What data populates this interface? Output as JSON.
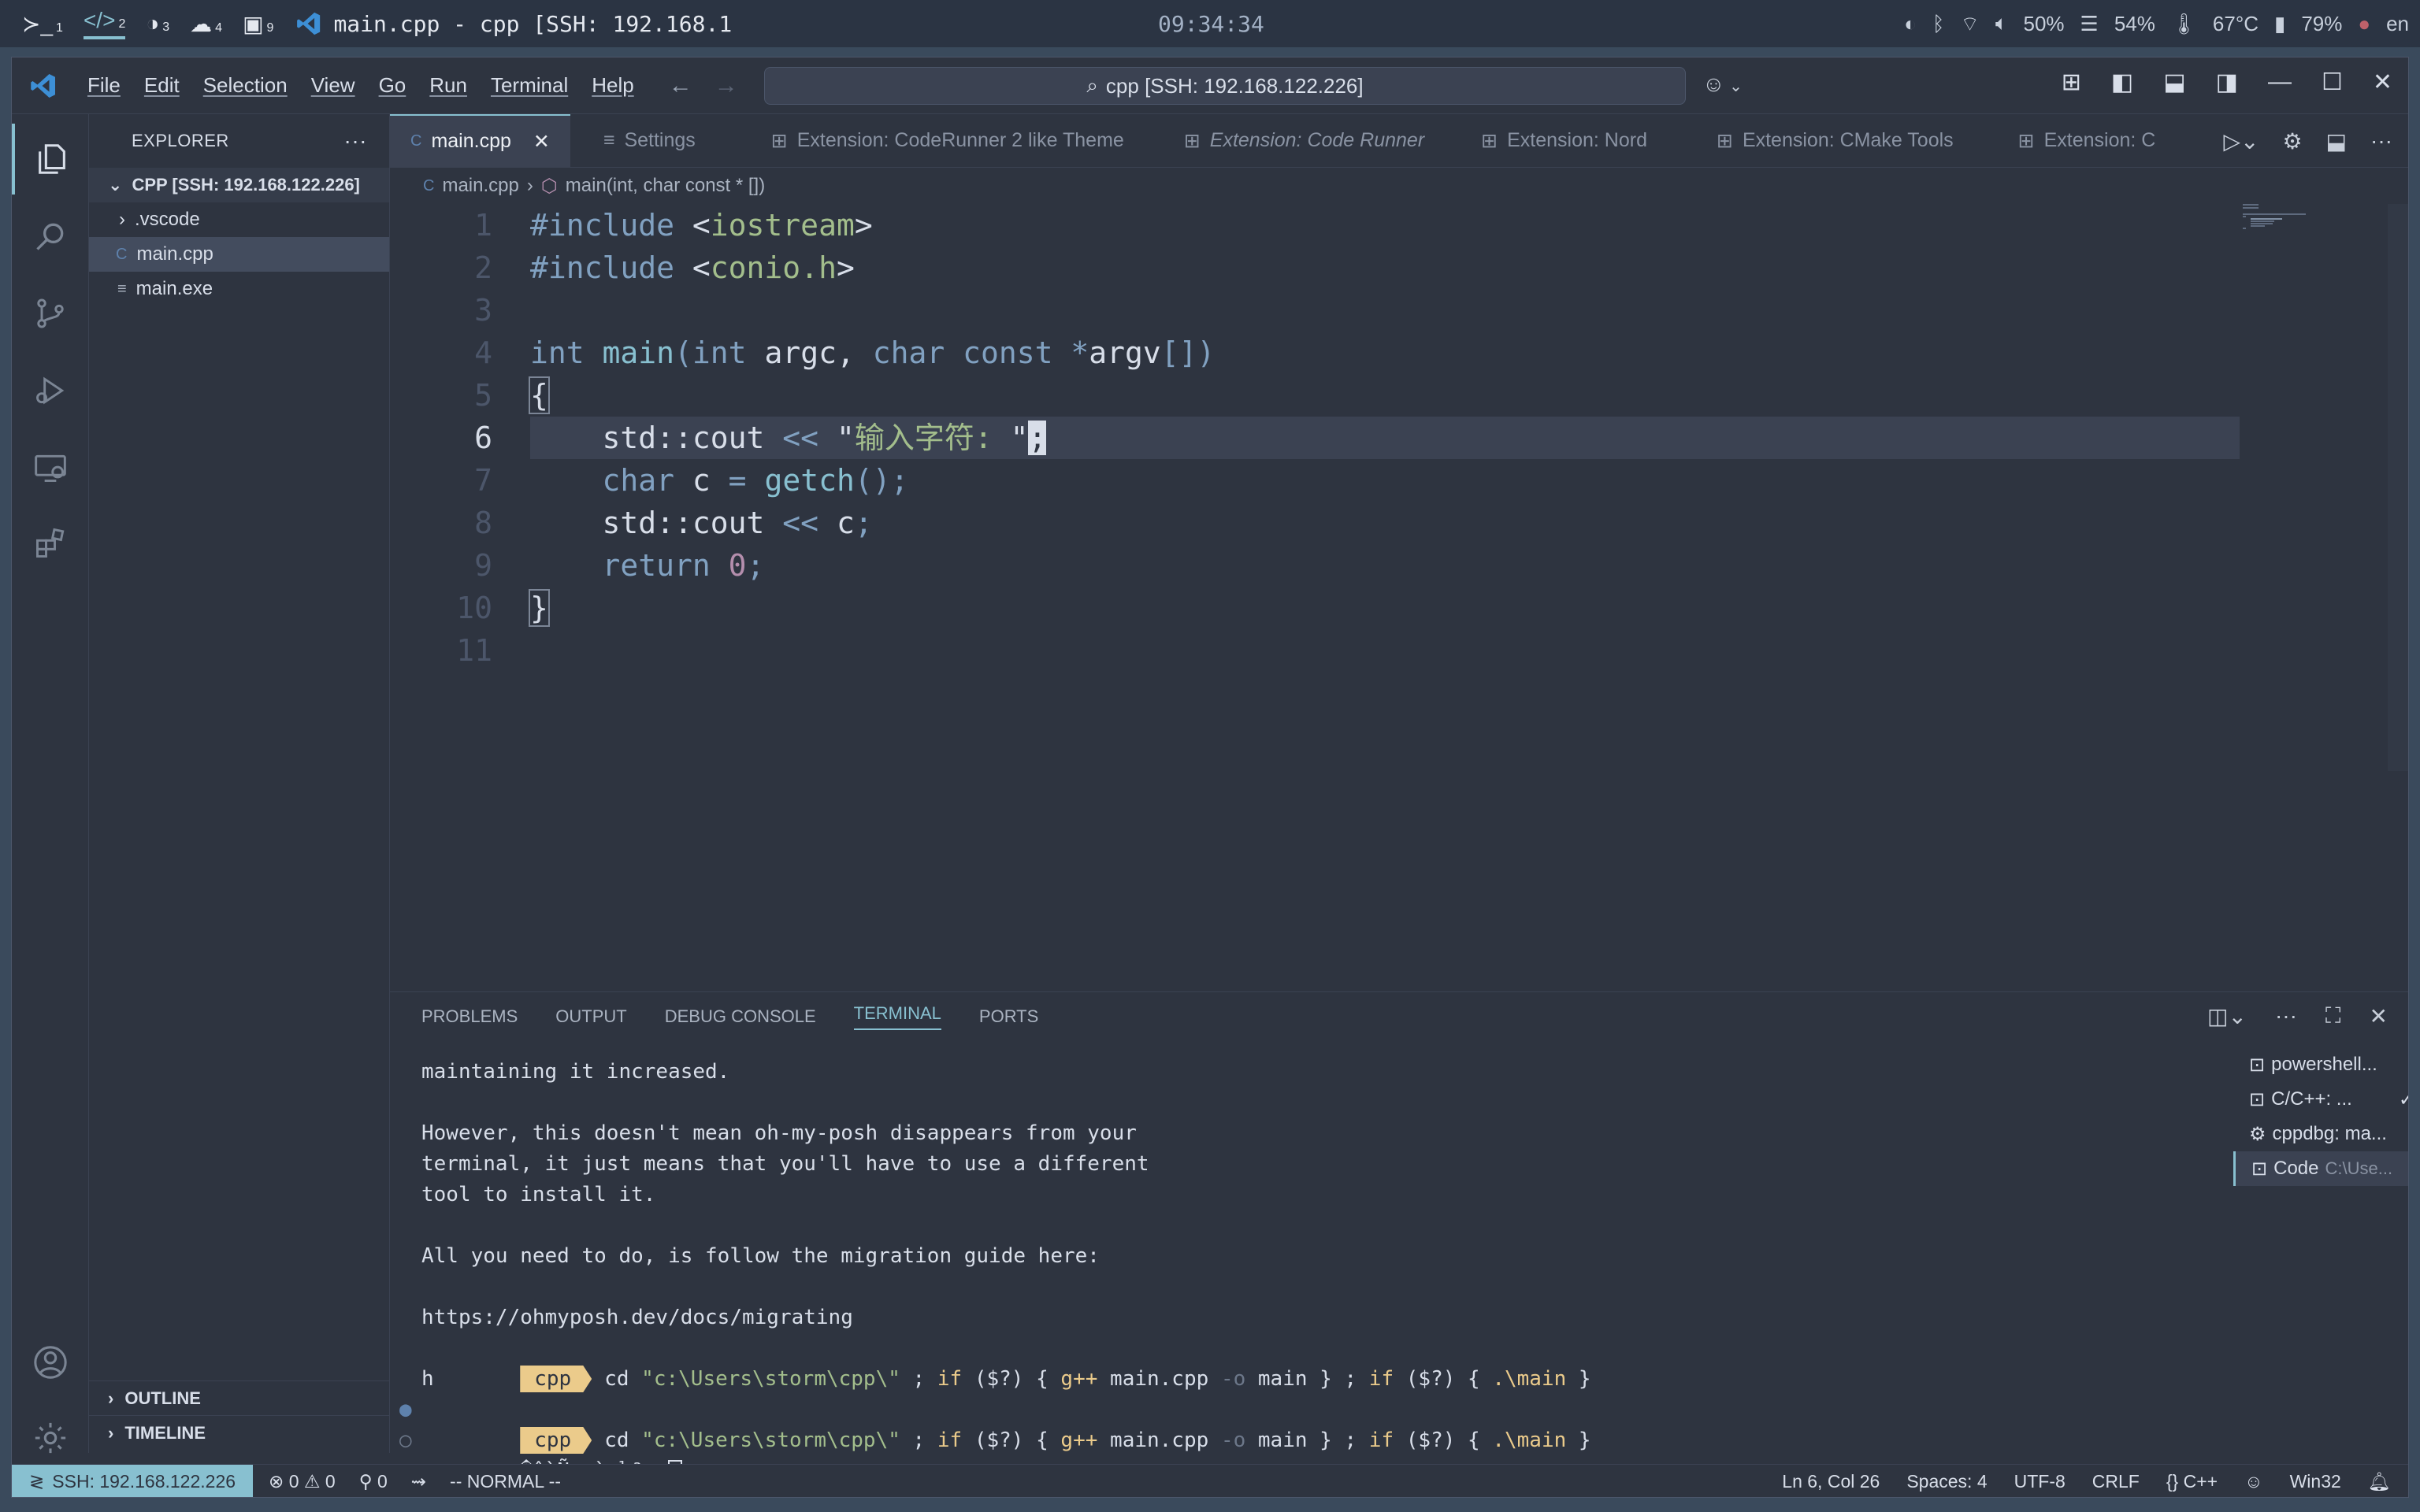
{
  "topbar": {
    "workspaces": [
      {
        "icon": "terminal-icon",
        "glyph": "≻_",
        "num": "1"
      },
      {
        "icon": "code-icon",
        "glyph": "</>",
        "num": "2"
      },
      {
        "icon": "moon-icon",
        "glyph": "◑",
        "num": "3"
      },
      {
        "icon": "wechat-icon",
        "glyph": "☁",
        "num": "4"
      },
      {
        "icon": "app-icon",
        "glyph": "▣",
        "num": "9"
      }
    ],
    "window_title": "main.cpp - cpp [SSH: 192.168.1",
    "clock": "09:34:34",
    "tray": {
      "brightness": "50%",
      "memory": "54%",
      "temperature": "67°C",
      "battery": "79%",
      "lang": "en"
    }
  },
  "titlebar": {
    "menu": [
      "File",
      "Edit",
      "Selection",
      "View",
      "Go",
      "Run",
      "Terminal",
      "Help"
    ],
    "command_center": "cpp [SSH: 192.168.122.226]"
  },
  "sidebar": {
    "header": "EXPLORER",
    "root": "CPP [SSH: 192.168.122.226]",
    "items": [
      {
        "label": ".vscode",
        "kind": "folder"
      },
      {
        "label": "main.cpp",
        "kind": "cpp"
      },
      {
        "label": "main.exe",
        "kind": "file"
      }
    ],
    "outline": "OUTLINE",
    "timeline": "TIMELINE"
  },
  "tabs": [
    {
      "label": "main.cpp",
      "active": true
    },
    {
      "label": "Settings"
    },
    {
      "label": "Extension: CodeRunner 2 like Theme"
    },
    {
      "label": "Extension: Code Runner",
      "italic": true
    },
    {
      "label": "Extension: Nord"
    },
    {
      "label": "Extension: CMake Tools"
    },
    {
      "label": "Extension: C"
    }
  ],
  "breadcrumb": {
    "file": "main.cpp",
    "symbol": "main(int, char const * [])"
  },
  "editor": {
    "current_line": 6,
    "line_numbers": [
      "1",
      "2",
      "3",
      "4",
      "5",
      "6",
      "7",
      "8",
      "9",
      "10",
      "11"
    ],
    "lines": [
      [
        {
          "t": "#include ",
          "c": "kw"
        },
        {
          "t": "<",
          "c": "br"
        },
        {
          "t": "iostream",
          "c": "str"
        },
        {
          "t": ">",
          "c": "br"
        }
      ],
      [
        {
          "t": "#include ",
          "c": "kw"
        },
        {
          "t": "<",
          "c": "br"
        },
        {
          "t": "conio.h",
          "c": "str"
        },
        {
          "t": ">",
          "c": "br"
        }
      ],
      [],
      [
        {
          "t": "int ",
          "c": "kw"
        },
        {
          "t": "main",
          "c": "fn"
        },
        {
          "t": "(",
          "c": "op"
        },
        {
          "t": "int ",
          "c": "kw"
        },
        {
          "t": "argc, ",
          "c": "br"
        },
        {
          "t": "char const ",
          "c": "kw"
        },
        {
          "t": "*",
          "c": "op"
        },
        {
          "t": "argv",
          "c": "br"
        },
        {
          "t": "[])",
          "c": "op"
        }
      ],
      [
        {
          "t": "{",
          "c": "brc"
        }
      ],
      [
        {
          "t": "    std::cout ",
          "c": "br"
        },
        {
          "t": "<< ",
          "c": "op"
        },
        {
          "t": "\"",
          "c": "br"
        },
        {
          "t": "输入字符: ",
          "c": "str"
        },
        {
          "t": "\"",
          "c": "br"
        },
        {
          "t": ";",
          "c": "cursor"
        }
      ],
      [
        {
          "t": "    ",
          "c": "br"
        },
        {
          "t": "char ",
          "c": "kw"
        },
        {
          "t": "c ",
          "c": "br"
        },
        {
          "t": "= ",
          "c": "op"
        },
        {
          "t": "getch",
          "c": "fn"
        },
        {
          "t": "();",
          "c": "op"
        }
      ],
      [
        {
          "t": "    std::cout ",
          "c": "br"
        },
        {
          "t": "<< ",
          "c": "op"
        },
        {
          "t": "c",
          "c": "br"
        },
        {
          "t": ";",
          "c": "op"
        }
      ],
      [
        {
          "t": "    ",
          "c": "br"
        },
        {
          "t": "return ",
          "c": "kw"
        },
        {
          "t": "0",
          "c": "num"
        },
        {
          "t": ";",
          "c": "op"
        }
      ],
      [
        {
          "t": "}",
          "c": "brc"
        }
      ],
      []
    ]
  },
  "panel": {
    "tabs": [
      "PROBLEMS",
      "OUTPUT",
      "DEBUG CONSOLE",
      "TERMINAL",
      "PORTS"
    ],
    "active_tab": "TERMINAL",
    "terminal_lines": [
      "maintaining it increased.",
      "",
      "However, this doesn't mean oh-my-posh disappears from your",
      "terminal, it just means that you'll have to use a different",
      "tool to install it.",
      "",
      "All you need to do, is follow the migration guide here:",
      "",
      "https://ohmyposh.dev/docs/migrating"
    ],
    "prompt_label": "cpp",
    "command": {
      "cd": "cd ",
      "path": "\"c:\\Users\\storm\\cpp\\\"",
      "sep1": " ; ",
      "if1": "if",
      "cond": " ($?) { ",
      "gpp": "g++",
      "args": " main.cpp ",
      "flag": "-o",
      "out": " main } ; ",
      "if2": "if",
      "cond2": " ($?) { ",
      "run": ".\\main",
      "close": " }"
    },
    "output_h": "h",
    "garbled": "�ôàÑσ¡ùτ¼ª: ",
    "terminals": [
      {
        "label": "powershell...",
        "sub": ""
      },
      {
        "label": "C/C++: ...",
        "sub": ""
      },
      {
        "label": "cppdbg: ma...",
        "sub": ""
      },
      {
        "label": "Code",
        "sub": "C:\\Use..."
      }
    ]
  },
  "status": {
    "remote": "SSH: 192.168.122.226",
    "errors": "0",
    "warnings": "0",
    "ports": "0",
    "mode": "-- NORMAL --",
    "position": "Ln 6, Col 26",
    "spaces": "Spaces: 4",
    "encoding": "UTF-8",
    "eol": "CRLF",
    "language": "C++",
    "platform": "Win32"
  }
}
